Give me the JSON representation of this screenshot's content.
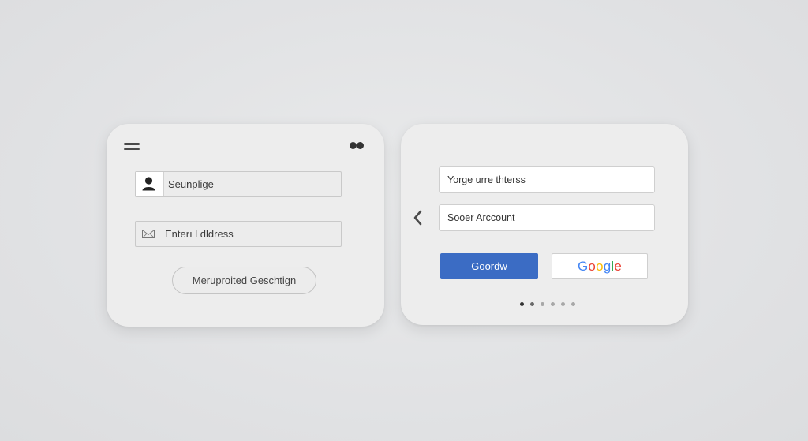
{
  "left_card": {
    "username_label": "Seunplige",
    "email_label": "Enterı l dldress",
    "action_label": "Meruproited Geschtign"
  },
  "right_card": {
    "field1_label": "Yorge urre thterss",
    "field2_label": "Sooer Arccount",
    "primary_button_label": "Goordw",
    "google_button_letters": [
      "G",
      "o",
      "o",
      "g",
      "l",
      "e"
    ],
    "pager_total": 6,
    "pager_active_index": 0
  },
  "colors": {
    "primary_blue": "#3b6cc4",
    "google_blue": "#4285f4",
    "google_red": "#ea4335",
    "google_yellow": "#fbbc05",
    "google_green": "#34a853"
  },
  "icons": [
    "menu-icon",
    "dots-icon",
    "user-icon",
    "mail-icon",
    "chevron-left-icon"
  ]
}
